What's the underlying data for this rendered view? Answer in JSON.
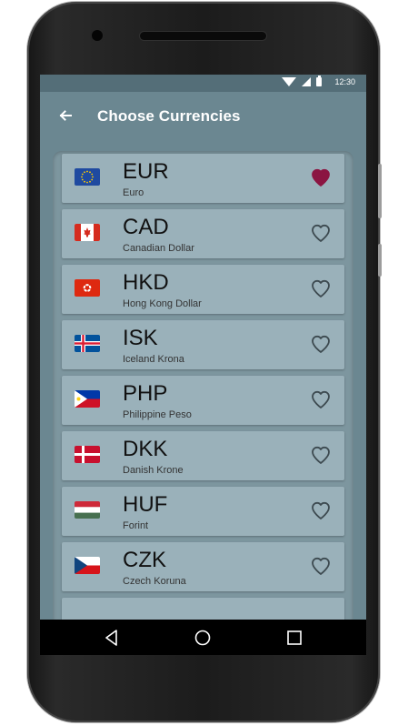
{
  "status": {
    "time": "12:30"
  },
  "toolbar": {
    "title": "Choose Currencies",
    "back_icon": "arrow-left-icon"
  },
  "currencies": [
    {
      "code": "EUR",
      "name": "Euro",
      "favorite": true,
      "flag": "eu-flag"
    },
    {
      "code": "CAD",
      "name": "Canadian Dollar",
      "favorite": false,
      "flag": "ca-flag"
    },
    {
      "code": "HKD",
      "name": "Hong Kong Dollar",
      "favorite": false,
      "flag": "hk-flag"
    },
    {
      "code": "ISK",
      "name": "Iceland Krona",
      "favorite": false,
      "flag": "is-flag"
    },
    {
      "code": "PHP",
      "name": "Philippine Peso",
      "favorite": false,
      "flag": "ph-flag"
    },
    {
      "code": "DKK",
      "name": "Danish Krone",
      "favorite": false,
      "flag": "dk-flag"
    },
    {
      "code": "HUF",
      "name": "Forint",
      "favorite": false,
      "flag": "hu-flag"
    },
    {
      "code": "CZK",
      "name": "Czech Koruna",
      "favorite": false,
      "flag": "cz-flag"
    }
  ],
  "colors": {
    "favorite": "#8b1542",
    "outline": "#3d4a50",
    "toolbar": "#6b8791"
  }
}
